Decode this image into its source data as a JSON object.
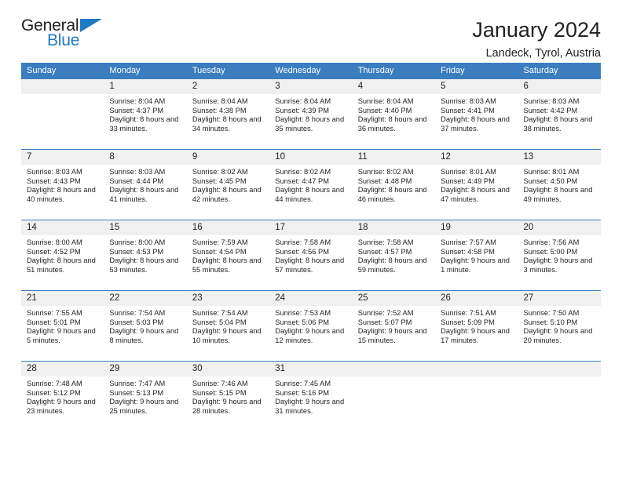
{
  "brand": {
    "word_one": "General",
    "word_two": "Blue",
    "accent_color": "#1f7ac4",
    "triangle_icon": "triangle-icon"
  },
  "header": {
    "title": "January 2024",
    "subtitle": "Landeck, Tyrol, Austria"
  },
  "calendar": {
    "header_bg": "#3b7dbf",
    "header_text_color": "#ffffff",
    "daynum_bg": "#f0f0f0",
    "weekday_headers": [
      "Sunday",
      "Monday",
      "Tuesday",
      "Wednesday",
      "Thursday",
      "Friday",
      "Saturday"
    ],
    "weeks": [
      [
        {
          "day": "",
          "sunrise": "",
          "sunset": "",
          "daylight": "",
          "empty": true
        },
        {
          "day": "1",
          "sunrise": "Sunrise: 8:04 AM",
          "sunset": "Sunset: 4:37 PM",
          "daylight": "Daylight: 8 hours and 33 minutes."
        },
        {
          "day": "2",
          "sunrise": "Sunrise: 8:04 AM",
          "sunset": "Sunset: 4:38 PM",
          "daylight": "Daylight: 8 hours and 34 minutes."
        },
        {
          "day": "3",
          "sunrise": "Sunrise: 8:04 AM",
          "sunset": "Sunset: 4:39 PM",
          "daylight": "Daylight: 8 hours and 35 minutes."
        },
        {
          "day": "4",
          "sunrise": "Sunrise: 8:04 AM",
          "sunset": "Sunset: 4:40 PM",
          "daylight": "Daylight: 8 hours and 36 minutes."
        },
        {
          "day": "5",
          "sunrise": "Sunrise: 8:03 AM",
          "sunset": "Sunset: 4:41 PM",
          "daylight": "Daylight: 8 hours and 37 minutes."
        },
        {
          "day": "6",
          "sunrise": "Sunrise: 8:03 AM",
          "sunset": "Sunset: 4:42 PM",
          "daylight": "Daylight: 8 hours and 38 minutes."
        }
      ],
      [
        {
          "day": "7",
          "sunrise": "Sunrise: 8:03 AM",
          "sunset": "Sunset: 4:43 PM",
          "daylight": "Daylight: 8 hours and 40 minutes."
        },
        {
          "day": "8",
          "sunrise": "Sunrise: 8:03 AM",
          "sunset": "Sunset: 4:44 PM",
          "daylight": "Daylight: 8 hours and 41 minutes."
        },
        {
          "day": "9",
          "sunrise": "Sunrise: 8:02 AM",
          "sunset": "Sunset: 4:45 PM",
          "daylight": "Daylight: 8 hours and 42 minutes."
        },
        {
          "day": "10",
          "sunrise": "Sunrise: 8:02 AM",
          "sunset": "Sunset: 4:47 PM",
          "daylight": "Daylight: 8 hours and 44 minutes."
        },
        {
          "day": "11",
          "sunrise": "Sunrise: 8:02 AM",
          "sunset": "Sunset: 4:48 PM",
          "daylight": "Daylight: 8 hours and 46 minutes."
        },
        {
          "day": "12",
          "sunrise": "Sunrise: 8:01 AM",
          "sunset": "Sunset: 4:49 PM",
          "daylight": "Daylight: 8 hours and 47 minutes."
        },
        {
          "day": "13",
          "sunrise": "Sunrise: 8:01 AM",
          "sunset": "Sunset: 4:50 PM",
          "daylight": "Daylight: 8 hours and 49 minutes."
        }
      ],
      [
        {
          "day": "14",
          "sunrise": "Sunrise: 8:00 AM",
          "sunset": "Sunset: 4:52 PM",
          "daylight": "Daylight: 8 hours and 51 minutes."
        },
        {
          "day": "15",
          "sunrise": "Sunrise: 8:00 AM",
          "sunset": "Sunset: 4:53 PM",
          "daylight": "Daylight: 8 hours and 53 minutes."
        },
        {
          "day": "16",
          "sunrise": "Sunrise: 7:59 AM",
          "sunset": "Sunset: 4:54 PM",
          "daylight": "Daylight: 8 hours and 55 minutes."
        },
        {
          "day": "17",
          "sunrise": "Sunrise: 7:58 AM",
          "sunset": "Sunset: 4:56 PM",
          "daylight": "Daylight: 8 hours and 57 minutes."
        },
        {
          "day": "18",
          "sunrise": "Sunrise: 7:58 AM",
          "sunset": "Sunset: 4:57 PM",
          "daylight": "Daylight: 8 hours and 59 minutes."
        },
        {
          "day": "19",
          "sunrise": "Sunrise: 7:57 AM",
          "sunset": "Sunset: 4:58 PM",
          "daylight": "Daylight: 9 hours and 1 minute."
        },
        {
          "day": "20",
          "sunrise": "Sunrise: 7:56 AM",
          "sunset": "Sunset: 5:00 PM",
          "daylight": "Daylight: 9 hours and 3 minutes."
        }
      ],
      [
        {
          "day": "21",
          "sunrise": "Sunrise: 7:55 AM",
          "sunset": "Sunset: 5:01 PM",
          "daylight": "Daylight: 9 hours and 5 minutes."
        },
        {
          "day": "22",
          "sunrise": "Sunrise: 7:54 AM",
          "sunset": "Sunset: 5:03 PM",
          "daylight": "Daylight: 9 hours and 8 minutes."
        },
        {
          "day": "23",
          "sunrise": "Sunrise: 7:54 AM",
          "sunset": "Sunset: 5:04 PM",
          "daylight": "Daylight: 9 hours and 10 minutes."
        },
        {
          "day": "24",
          "sunrise": "Sunrise: 7:53 AM",
          "sunset": "Sunset: 5:06 PM",
          "daylight": "Daylight: 9 hours and 12 minutes."
        },
        {
          "day": "25",
          "sunrise": "Sunrise: 7:52 AM",
          "sunset": "Sunset: 5:07 PM",
          "daylight": "Daylight: 9 hours and 15 minutes."
        },
        {
          "day": "26",
          "sunrise": "Sunrise: 7:51 AM",
          "sunset": "Sunset: 5:09 PM",
          "daylight": "Daylight: 9 hours and 17 minutes."
        },
        {
          "day": "27",
          "sunrise": "Sunrise: 7:50 AM",
          "sunset": "Sunset: 5:10 PM",
          "daylight": "Daylight: 9 hours and 20 minutes."
        }
      ],
      [
        {
          "day": "28",
          "sunrise": "Sunrise: 7:48 AM",
          "sunset": "Sunset: 5:12 PM",
          "daylight": "Daylight: 9 hours and 23 minutes."
        },
        {
          "day": "29",
          "sunrise": "Sunrise: 7:47 AM",
          "sunset": "Sunset: 5:13 PM",
          "daylight": "Daylight: 9 hours and 25 minutes."
        },
        {
          "day": "30",
          "sunrise": "Sunrise: 7:46 AM",
          "sunset": "Sunset: 5:15 PM",
          "daylight": "Daylight: 9 hours and 28 minutes."
        },
        {
          "day": "31",
          "sunrise": "Sunrise: 7:45 AM",
          "sunset": "Sunset: 5:16 PM",
          "daylight": "Daylight: 9 hours and 31 minutes."
        },
        {
          "day": "",
          "sunrise": "",
          "sunset": "",
          "daylight": "",
          "empty": true
        },
        {
          "day": "",
          "sunrise": "",
          "sunset": "",
          "daylight": "",
          "empty": true
        },
        {
          "day": "",
          "sunrise": "",
          "sunset": "",
          "daylight": "",
          "empty": true
        }
      ]
    ]
  }
}
